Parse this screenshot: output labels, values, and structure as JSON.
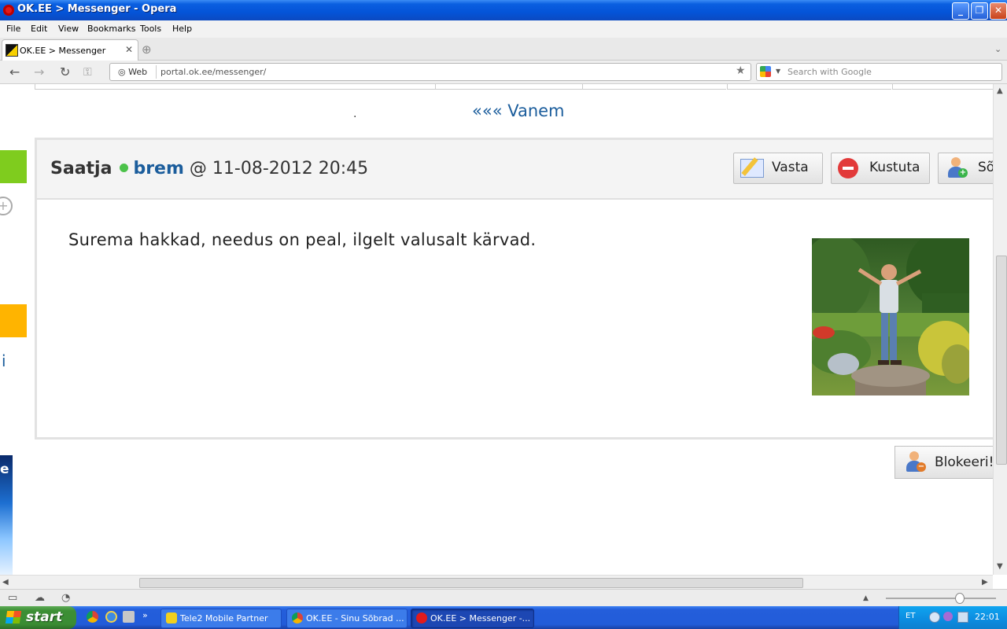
{
  "window": {
    "title": "OK.EE > Messenger - Opera"
  },
  "menu": [
    "File",
    "Edit",
    "View",
    "Bookmarks",
    "Tools",
    "Help"
  ],
  "tab": {
    "label": "OK.EE > Messenger"
  },
  "addressbar": {
    "web_label": "Web",
    "url": "portal.ok.ee/messenger/",
    "search_placeholder": "Search with Google"
  },
  "page": {
    "older_link": "««« Vanem",
    "message": {
      "sender_label": "Saatja",
      "username": "brem",
      "datetime": "@ 11-08-2012 20:45",
      "text": "Surema hakkad, needus on peal, ilgelt valusalt kärvad."
    },
    "buttons": {
      "reply": "Vasta",
      "delete": "Kustuta",
      "friend": "Sõ",
      "block": "Blokeeri!"
    },
    "side_fragments": {
      "left_link": "i",
      "banner_letter": "e"
    }
  },
  "taskbar": {
    "start_label": "start",
    "items": [
      "Tele2 Mobile Partner",
      "OK.EE - Sinu Sõbrad ...",
      "OK.EE > Messenger -..."
    ],
    "lang": "ET",
    "clock": "22:01"
  },
  "colors": {
    "link": "#1b5d9c",
    "online": "#4cc24a",
    "green_block": "#7fcc1e",
    "orange_block": "#ffb400"
  }
}
